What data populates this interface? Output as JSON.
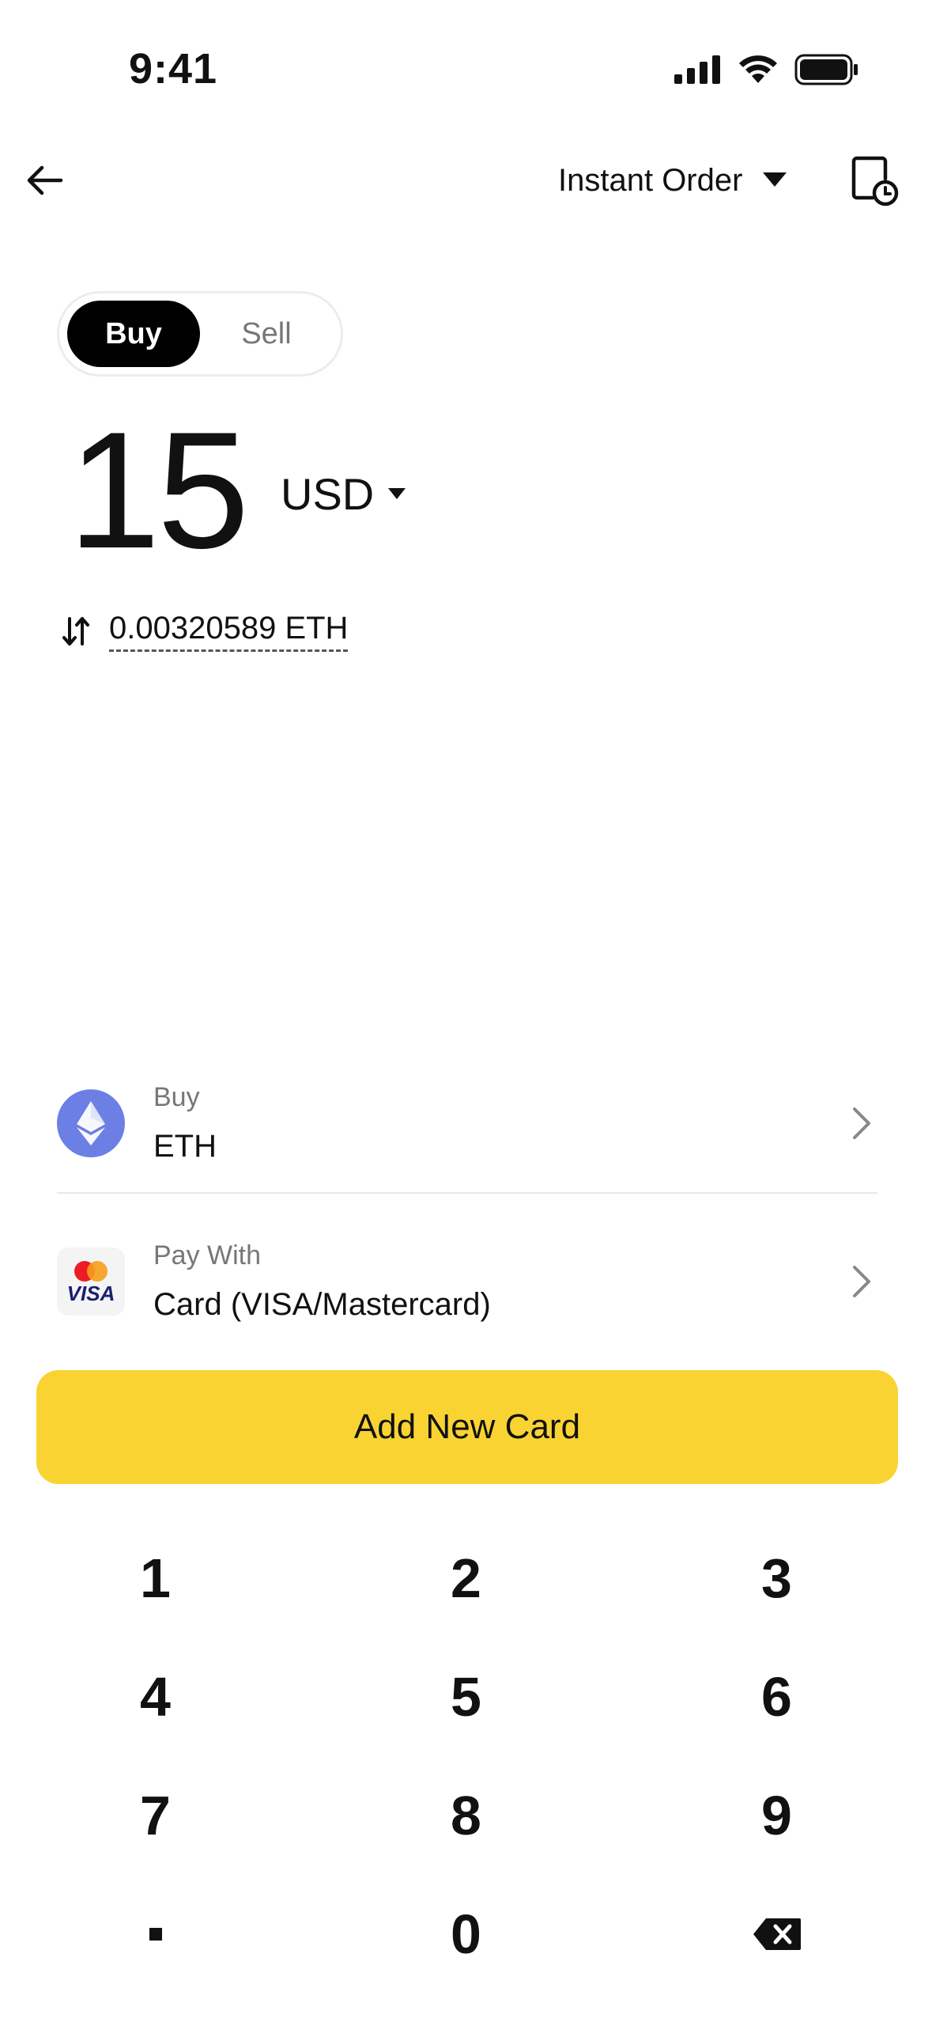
{
  "status_bar": {
    "time": "9:41"
  },
  "header": {
    "order_type": "Instant Order"
  },
  "toggle": {
    "buy": "Buy",
    "sell": "Sell"
  },
  "amount": {
    "value": "15",
    "currency": "USD",
    "converted": "0.00320589 ETH"
  },
  "asset_row": {
    "label": "Buy",
    "value": "ETH"
  },
  "payment_row": {
    "label": "Pay With",
    "value": "Card (VISA/Mastercard)",
    "card_text": "VISA"
  },
  "cta": {
    "label": "Add New Card"
  },
  "keypad": {
    "keys": [
      "1",
      "2",
      "3",
      "4",
      "5",
      "6",
      "7",
      "8",
      "9",
      "",
      "0",
      ""
    ]
  },
  "colors": {
    "accent": "#f9d332",
    "eth": "#6c7fe5",
    "toggle_active": "#000000"
  },
  "icons": [
    "back-arrow-icon",
    "caret-down-icon",
    "order-history-icon",
    "swap-arrows-icon",
    "ethereum-icon",
    "card-brand-icon",
    "chevron-right-icon",
    "backspace-icon"
  ]
}
